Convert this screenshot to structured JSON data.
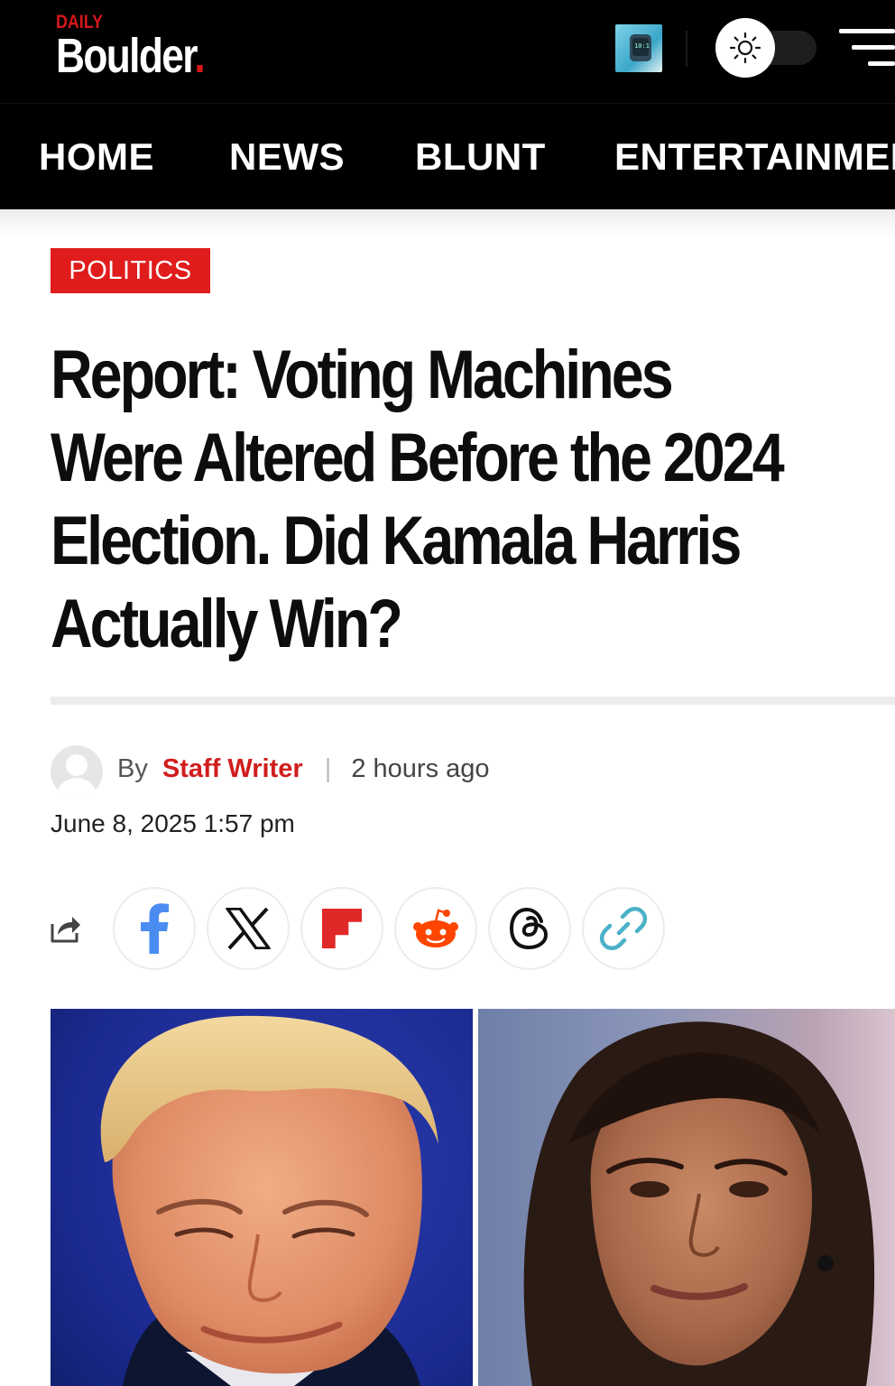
{
  "site": {
    "logo_small": "DAILY",
    "logo_name": "Boulder",
    "logo_dot": ".",
    "accent_color": "#d6171c"
  },
  "header": {
    "promo_thumb_text": "10:1",
    "theme_toggle_icon": "sun-icon",
    "menu_icon": "hamburger-menu-icon"
  },
  "nav": {
    "items": [
      {
        "label": "HOME"
      },
      {
        "label": "NEWS"
      },
      {
        "label": "BLUNT"
      },
      {
        "label": "ENTERTAINMEN"
      }
    ]
  },
  "article": {
    "category": "POLITICS",
    "headline_lines": [
      "Report: Voting Machines",
      "Were Altered Before the 2024",
      "Election. Did Kamala Harris",
      "Actually Win?"
    ],
    "by_label": "By",
    "author": "Staff Writer",
    "separator": "|",
    "relative_time": "2 hours ago",
    "date": "June 8, 2025 1:57 pm"
  },
  "share": {
    "icons": [
      "share-icon",
      "facebook-icon",
      "x-icon",
      "flipboard-icon",
      "reddit-icon",
      "threads-icon",
      "link-icon"
    ]
  }
}
